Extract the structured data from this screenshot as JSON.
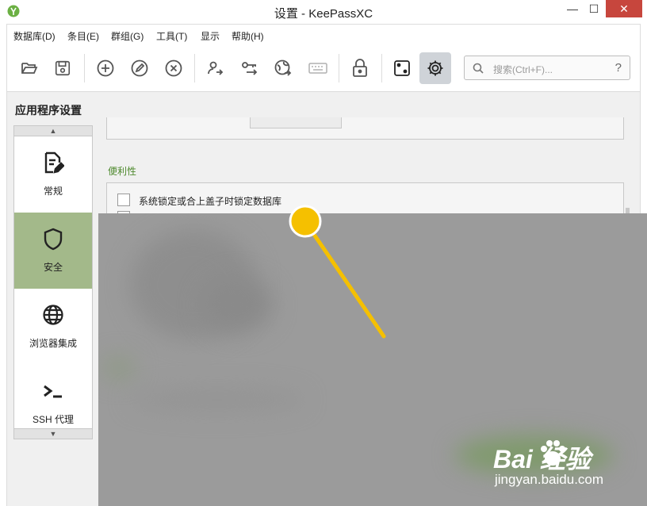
{
  "window": {
    "title": "设置 - KeePassXC",
    "minimize_glyph": "—",
    "maximize_glyph": "☐",
    "close_glyph": "✕"
  },
  "menu": [
    "数据库(D)",
    "条目(E)",
    "群组(G)",
    "工具(T)",
    "显示",
    "帮助(H)"
  ],
  "toolbar": {
    "buttons": [
      {
        "name": "open-database",
        "icon": "folder-open-icon"
      },
      {
        "name": "save-database",
        "icon": "save-icon"
      },
      {
        "name": "add-entry",
        "icon": "plus-circle-icon"
      },
      {
        "name": "edit-entry",
        "icon": "pencil-circle-icon"
      },
      {
        "name": "delete-entry",
        "icon": "x-circle-icon"
      },
      {
        "name": "copy-username",
        "icon": "user-arrow-icon"
      },
      {
        "name": "copy-password",
        "icon": "key-arrow-icon"
      },
      {
        "name": "copy-url",
        "icon": "globe-arrow-icon"
      },
      {
        "name": "auto-type",
        "icon": "keyboard-icon"
      },
      {
        "name": "lock-database",
        "icon": "lock-icon"
      },
      {
        "name": "password-generator",
        "icon": "dice-icon"
      },
      {
        "name": "settings",
        "icon": "gear-icon",
        "active": true
      }
    ],
    "search": {
      "placeholder": "搜索(Ctrl+F)...",
      "help": "?"
    }
  },
  "settings": {
    "heading": "应用程序设置",
    "categories": [
      {
        "label": "常规",
        "icon": "document-edit-icon",
        "selected": false
      },
      {
        "label": "安全",
        "icon": "shield-icon",
        "selected": true
      },
      {
        "label": "浏览器集成",
        "icon": "globe-icon",
        "selected": false
      },
      {
        "label": "SSH 代理",
        "icon": "terminal-icon",
        "selected": false
      }
    ],
    "scroll_up": "▲",
    "scroll_down": "▼",
    "section_convenience": "便利性",
    "options": [
      {
        "label": "系统锁定或合上盖子时锁定数据库",
        "checked": false
      }
    ]
  },
  "watermark": {
    "brand": "Bai 经验",
    "url": "jingyan.baidu.com"
  },
  "colors": {
    "accent_green": "#a3b98a",
    "section_green": "#4f8a2f",
    "close_red": "#c7463d",
    "pointer_yellow": "#f5c000"
  }
}
